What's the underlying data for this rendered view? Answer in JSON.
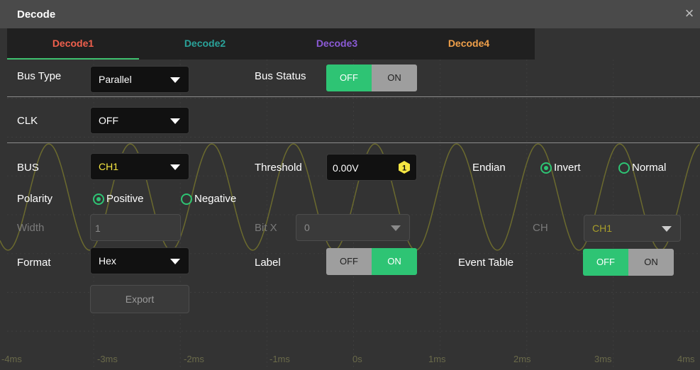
{
  "window": {
    "title": "Decode",
    "close_glyph": "×"
  },
  "tabs": [
    {
      "label": "Decode1",
      "color": "#f0604d",
      "active": true
    },
    {
      "label": "Decode2",
      "color": "#2aa39a",
      "active": false
    },
    {
      "label": "Decode3",
      "color": "#8b5ad6",
      "active": false
    },
    {
      "label": "Decode4",
      "color": "#f0a04a",
      "active": false
    }
  ],
  "bus_type": {
    "label": "Bus Type",
    "value": "Parallel"
  },
  "bus_status": {
    "label": "Bus Status",
    "off": "OFF",
    "on": "ON",
    "state": "OFF"
  },
  "clk": {
    "label": "CLK",
    "value": "OFF"
  },
  "bus": {
    "label": "BUS",
    "value": "CH1",
    "value_color": "#f5e642"
  },
  "threshold": {
    "label": "Threshold",
    "value": "0.00V",
    "badge": "1"
  },
  "endian": {
    "label": "Endian",
    "options": [
      "Invert",
      "Normal"
    ],
    "selected": "Invert"
  },
  "polarity": {
    "label": "Polarity",
    "options": [
      "Positive",
      "Negative"
    ],
    "selected": "Positive"
  },
  "width": {
    "label": "Width",
    "value": "1"
  },
  "bit_x": {
    "label": "Bit X",
    "value": "0"
  },
  "ch": {
    "label": "CH",
    "value": "CH1"
  },
  "format": {
    "label": "Format",
    "value": "Hex"
  },
  "label_toggle": {
    "label": "Label",
    "off": "OFF",
    "on": "ON",
    "state": "ON"
  },
  "event_table": {
    "label": "Event Table",
    "off": "OFF",
    "on": "ON",
    "state": "OFF"
  },
  "export": {
    "label": "Export"
  },
  "time_axis": [
    "-4ms",
    "-3ms",
    "-2ms",
    "-1ms",
    "0s",
    "1ms",
    "2ms",
    "3ms",
    "4ms"
  ],
  "colors": {
    "accent_green": "#2ec474",
    "toggle_grey": "#9e9e9e",
    "ch1_yellow": "#f5e642"
  }
}
